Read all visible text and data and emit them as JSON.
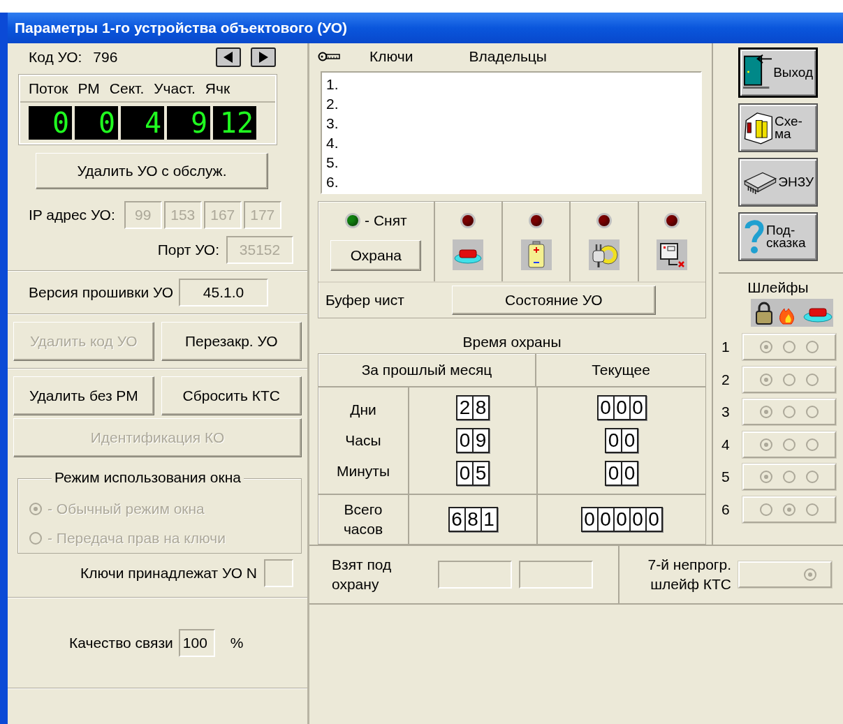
{
  "window": {
    "title": "Параметры 1-го устройства объектового (УО)"
  },
  "device": {
    "label": "Код УО:",
    "code": "796"
  },
  "address": {
    "columns": [
      "Поток",
      "РМ",
      "Сект.",
      "Участ.",
      "Ячк"
    ],
    "digits": [
      "0",
      "0",
      "4",
      "9",
      "12"
    ]
  },
  "remove_button": {
    "label": "Удалить УО с обслуж.",
    "disabled": false
  },
  "ip": {
    "label": "IP адрес УО:",
    "disabled": true,
    "octets": [
      "99",
      "153",
      "167",
      "177"
    ]
  },
  "port": {
    "label": "Порт УО:",
    "disabled": true,
    "value": "35152"
  },
  "firmware": {
    "label": "Версия прошивки УО",
    "value": "45.1.0"
  },
  "action_rows": [
    [
      {
        "label": "Удалить код УО",
        "disabled": true
      },
      {
        "label": "Перезакр. УО",
        "disabled": false
      }
    ],
    [
      {
        "label": "Удалить без РМ",
        "disabled": false
      },
      {
        "label": "Сбросить КТС",
        "disabled": false
      }
    ],
    [
      {
        "label": "Идентификация КО",
        "disabled": true
      }
    ]
  ],
  "window_mode": {
    "title": "Режим использования окна",
    "disabled": true,
    "options": [
      {
        "label": "- Обычный режим окна",
        "selected": true
      },
      {
        "label": "- Передача прав на ключи",
        "selected": false
      }
    ]
  },
  "keys_owner": {
    "label": "Ключи принадлежат УО N"
  },
  "link_quality": {
    "label": "Качество связи",
    "value": "100",
    "unit": "%"
  },
  "keys": {
    "columns": [
      "Ключи",
      "Владельцы"
    ],
    "rows": [
      "1.",
      "2.",
      "3.",
      "4.",
      "5.",
      "6."
    ]
  },
  "indicators": [
    {
      "kind": "state",
      "color": "#108010",
      "label": "- Снят",
      "button": "Охрана"
    },
    {
      "kind": "alarm",
      "color": "#7a0000"
    },
    {
      "kind": "battery",
      "color": "#7a0000"
    },
    {
      "kind": "power",
      "color": "#7a0000"
    },
    {
      "kind": "link",
      "color": "#7a0000"
    }
  ],
  "buffer": {
    "status": "Буфер чист",
    "button": "Состояние УО"
  },
  "guard_time": {
    "title": "Время охраны",
    "columns": [
      "За прошлый месяц",
      "Текущее"
    ],
    "rows": [
      {
        "label": "Дни",
        "last_month": [
          "2",
          "8"
        ],
        "current": [
          "0",
          "0",
          "0"
        ]
      },
      {
        "label": "Часы",
        "last_month": [
          "0",
          "9"
        ],
        "current": [
          "0",
          "0"
        ]
      },
      {
        "label": "Минуты",
        "last_month": [
          "0",
          "5"
        ],
        "current": [
          "0",
          "0"
        ]
      }
    ],
    "total": {
      "label": "Всего часов",
      "last_month": [
        "6",
        "8",
        "1"
      ],
      "current": [
        "0",
        "0",
        "0",
        "0",
        "0"
      ]
    }
  },
  "armed_at": {
    "label": "Взят под охрану"
  },
  "ktc_loop": {
    "label": "7-й непрогр. шлейф КТС",
    "selected": true,
    "disabled": true
  },
  "side_buttons": [
    {
      "kind": "exit",
      "label": "Выход",
      "default": true
    },
    {
      "kind": "scheme",
      "label": "Схе-ма",
      "default": false
    },
    {
      "kind": "memory",
      "label": "ЭНЗУ",
      "default": false
    },
    {
      "kind": "help",
      "label": "Под-сказка",
      "default": false
    }
  ],
  "loops": {
    "title": "Шлейфы",
    "disabled": true,
    "rows": [
      {
        "number": "1",
        "options": [
          {
            "selected": true
          },
          {
            "selected": false
          },
          {
            "selected": false
          }
        ]
      },
      {
        "number": "2",
        "options": [
          {
            "selected": true
          },
          {
            "selected": false
          },
          {
            "selected": false
          }
        ]
      },
      {
        "number": "3",
        "options": [
          {
            "selected": true
          },
          {
            "selected": false
          },
          {
            "selected": false
          }
        ]
      },
      {
        "number": "4",
        "options": [
          {
            "selected": true
          },
          {
            "selected": false
          },
          {
            "selected": false
          }
        ]
      },
      {
        "number": "5",
        "options": [
          {
            "selected": true
          },
          {
            "selected": false
          },
          {
            "selected": false
          }
        ]
      },
      {
        "number": "6",
        "options": [
          {
            "selected": false
          },
          {
            "selected": true
          },
          {
            "selected": false
          }
        ]
      }
    ]
  }
}
